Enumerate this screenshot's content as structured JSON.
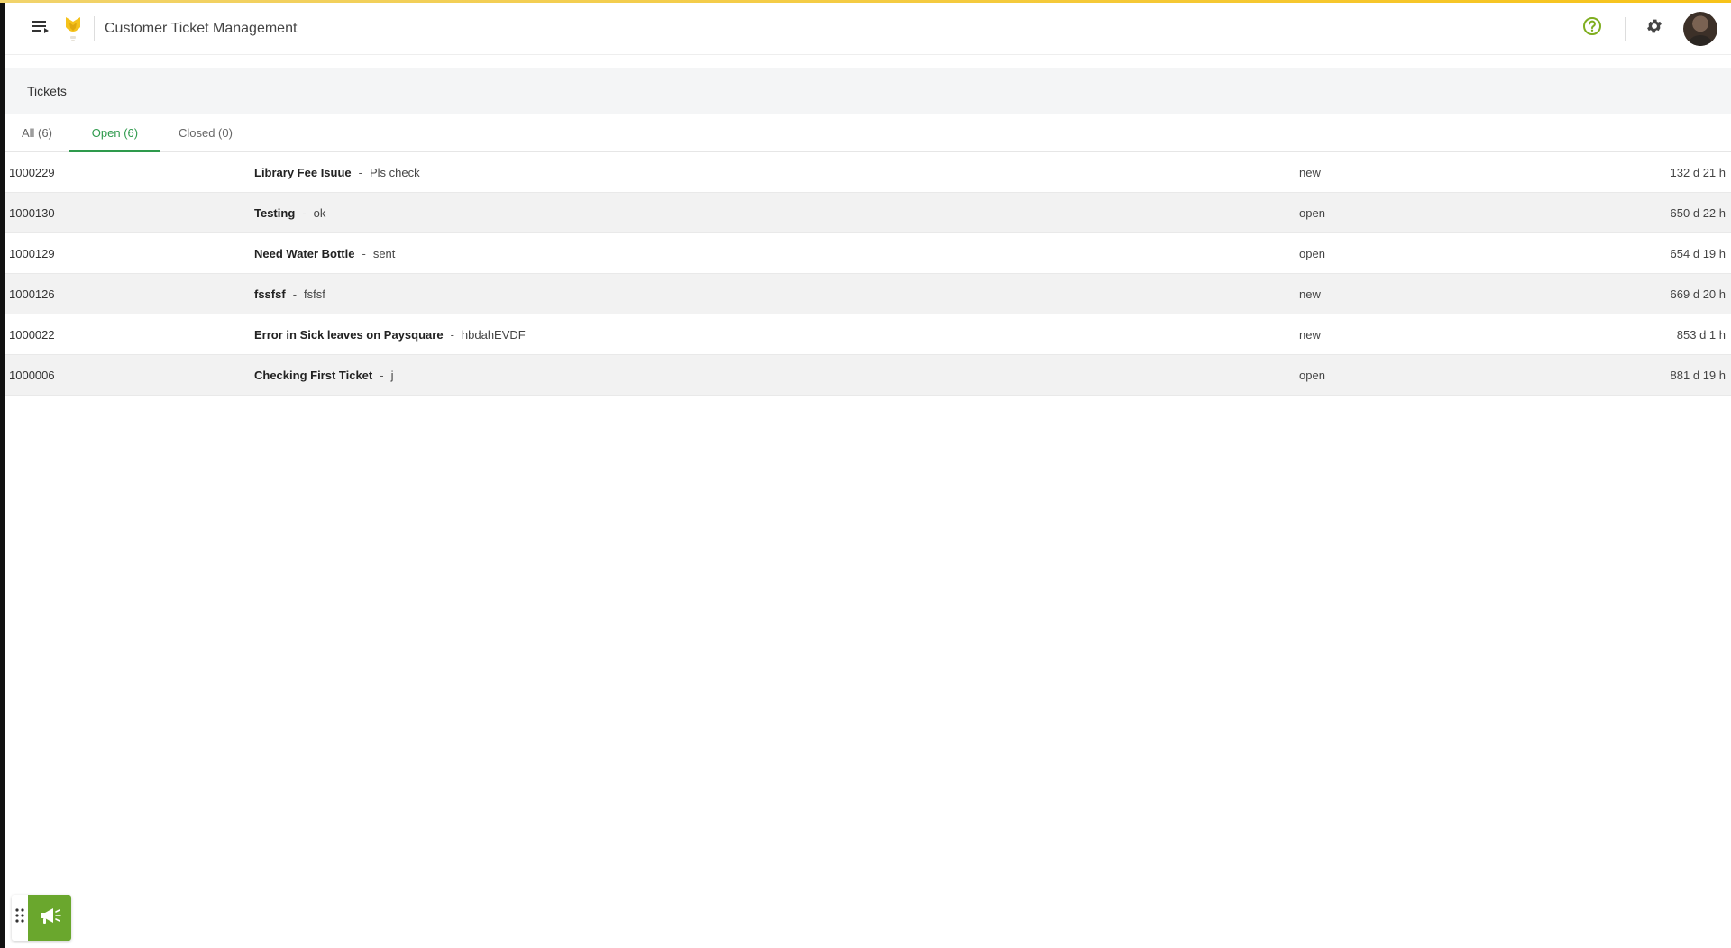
{
  "header": {
    "app_title": "Customer Ticket Management",
    "icons": {
      "menu": "menu-icon",
      "logo": "brand-logo",
      "help": "help-circle-icon",
      "settings": "gear-icon",
      "avatar": "user-avatar"
    }
  },
  "section": {
    "title": "Tickets"
  },
  "tabs": [
    {
      "label": "All (6)",
      "active": false
    },
    {
      "label": "Open (6)",
      "active": true
    },
    {
      "label": "Closed (0)",
      "active": false
    }
  ],
  "tickets": [
    {
      "id": "1000229",
      "title": "Library Fee Isuue",
      "description": "Pls check",
      "status": "new",
      "age": "132 d 21 h"
    },
    {
      "id": "1000130",
      "title": "Testing",
      "description": "ok",
      "status": "open",
      "age": "650 d 22 h"
    },
    {
      "id": "1000129",
      "title": "Need Water Bottle",
      "description": "sent",
      "status": "open",
      "age": "654 d 19 h"
    },
    {
      "id": "1000126",
      "title": "fssfsf",
      "description": "fsfsf",
      "status": "new",
      "age": "669 d 20 h"
    },
    {
      "id": "1000022",
      "title": "Error in Sick leaves on Paysquare",
      "description": "hbdahEVDF",
      "status": "new",
      "age": "853 d 1 h"
    },
    {
      "id": "1000006",
      "title": "Checking First Ticket",
      "description": "j",
      "status": "open",
      "age": "881 d 19 h"
    }
  ],
  "subject_separator": "-",
  "colors": {
    "accent_green": "#2e9a4c",
    "widget_green": "#6aa72d",
    "top_bar_yellow": "#f7c31a",
    "help_icon": "#7fae1f"
  },
  "widget": {
    "icons": {
      "drag": "drag-handle-icon",
      "announce": "megaphone-icon"
    }
  }
}
